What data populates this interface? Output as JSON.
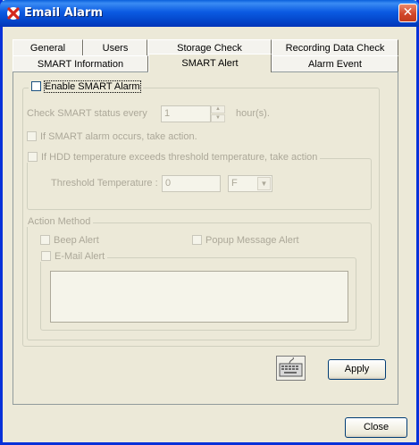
{
  "window": {
    "title": "Email Alarm",
    "close_glyph": "✕",
    "app_icon": "x-logo-icon"
  },
  "tabs": {
    "row1": [
      {
        "label": "General"
      },
      {
        "label": "Users"
      },
      {
        "label": "Storage Check"
      },
      {
        "label": "Recording Data Check"
      }
    ],
    "row2": [
      {
        "label": "SMART Information"
      },
      {
        "label": "SMART Alert"
      },
      {
        "label": "Alarm Event"
      }
    ],
    "active": "SMART Alert"
  },
  "smart_alert": {
    "enable_label": "Enable SMART Alarm",
    "enable_checked": false,
    "check_every_label": "Check SMART status every",
    "check_every_value": "1",
    "check_every_unit": "hour(s).",
    "take_action_label": "If SMART alarm occurs, take action.",
    "hdd_temp_label": "If HDD temperature exceeds threshold temperature, take action",
    "threshold_label": "Threshold Temperature :",
    "threshold_value": "0",
    "unit_value": "F",
    "action_method_label": "Action Method",
    "beep_label": "Beep Alert",
    "popup_label": "Popup Message Alert",
    "email_label": "E-Mail Alert",
    "email_text": ""
  },
  "footer": {
    "apply_label": "Apply",
    "close_label": "Close",
    "keyboard_icon": "keyboard-icon"
  }
}
